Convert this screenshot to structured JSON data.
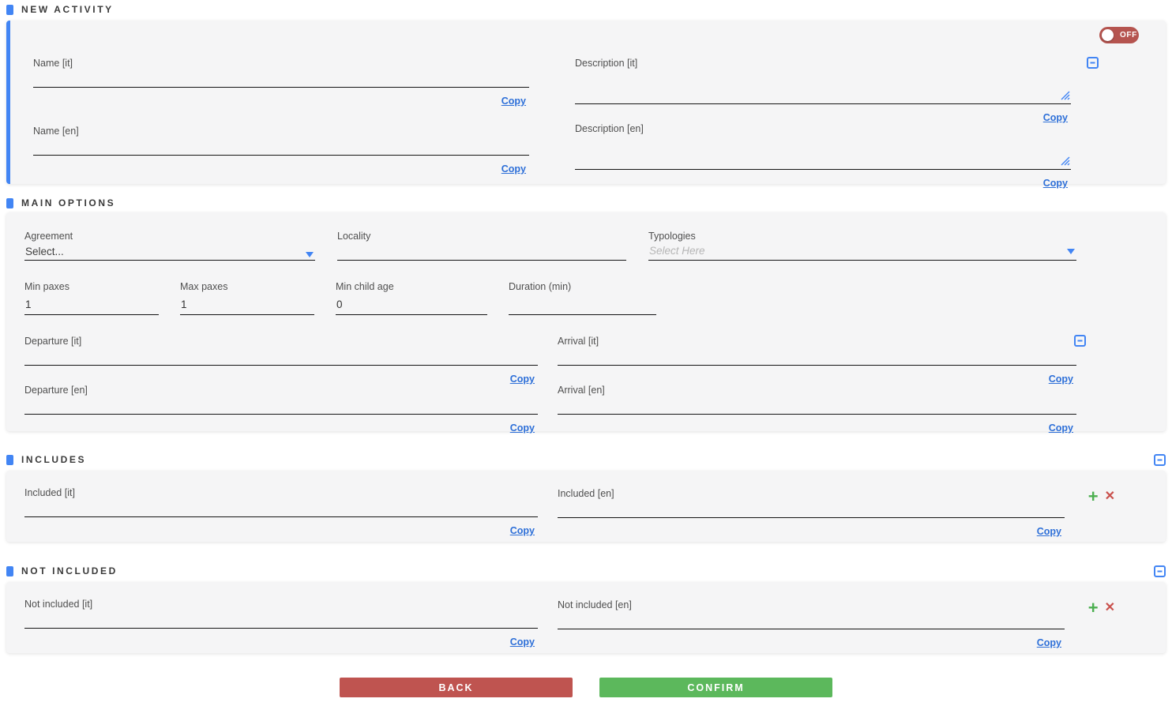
{
  "ui": {
    "copy_label": "Copy",
    "toggle": {
      "label": "OFF",
      "state": "off"
    },
    "buttons": {
      "back": "BACK",
      "confirm": "CONFIRM"
    },
    "icons": {
      "collapse": "minus-square",
      "add": "+",
      "remove": "✕"
    }
  },
  "colors": {
    "accent_blue": "#4285f4",
    "link_blue": "#2d6fd8",
    "toggle_red": "#b5544f",
    "back_red": "#bf5450",
    "confirm_green": "#5cb85c",
    "plus_green": "#4caf50",
    "remove_red": "#c9504c",
    "card_background": "#f5f5f6",
    "underline": "#141414"
  },
  "sections": {
    "new_activity": {
      "title": "NEW ACTIVITY",
      "name_it": {
        "label": "Name [it]",
        "value": ""
      },
      "name_en": {
        "label": "Name [en]",
        "value": ""
      },
      "desc_it": {
        "label": "Description [it]",
        "value": ""
      },
      "desc_en": {
        "label": "Description [en]",
        "value": ""
      }
    },
    "main_options": {
      "title": "MAIN OPTIONS",
      "agreement": {
        "label": "Agreement",
        "value": "Select..."
      },
      "locality": {
        "label": "Locality",
        "value": ""
      },
      "typologies": {
        "label": "Typologies",
        "placeholder": "Select Here"
      },
      "min_paxes": {
        "label": "Min paxes",
        "value": "1"
      },
      "max_paxes": {
        "label": "Max paxes",
        "value": "1"
      },
      "min_child_age": {
        "label": "Min child age",
        "value": "0"
      },
      "duration": {
        "label": "Duration (min)",
        "value": ""
      },
      "departure_it": {
        "label": "Departure [it]",
        "value": ""
      },
      "departure_en": {
        "label": "Departure [en]",
        "value": ""
      },
      "arrival_it": {
        "label": "Arrival [it]",
        "value": ""
      },
      "arrival_en": {
        "label": "Arrival [en]",
        "value": ""
      }
    },
    "includes": {
      "title": "INCLUDES",
      "included_it": {
        "label": "Included [it]",
        "value": ""
      },
      "included_en": {
        "label": "Included [en]",
        "value": ""
      }
    },
    "not_included": {
      "title": "NOT INCLUDED",
      "not_included_it": {
        "label": "Not included [it]",
        "value": ""
      },
      "not_included_en": {
        "label": "Not included [en]",
        "value": ""
      }
    }
  }
}
